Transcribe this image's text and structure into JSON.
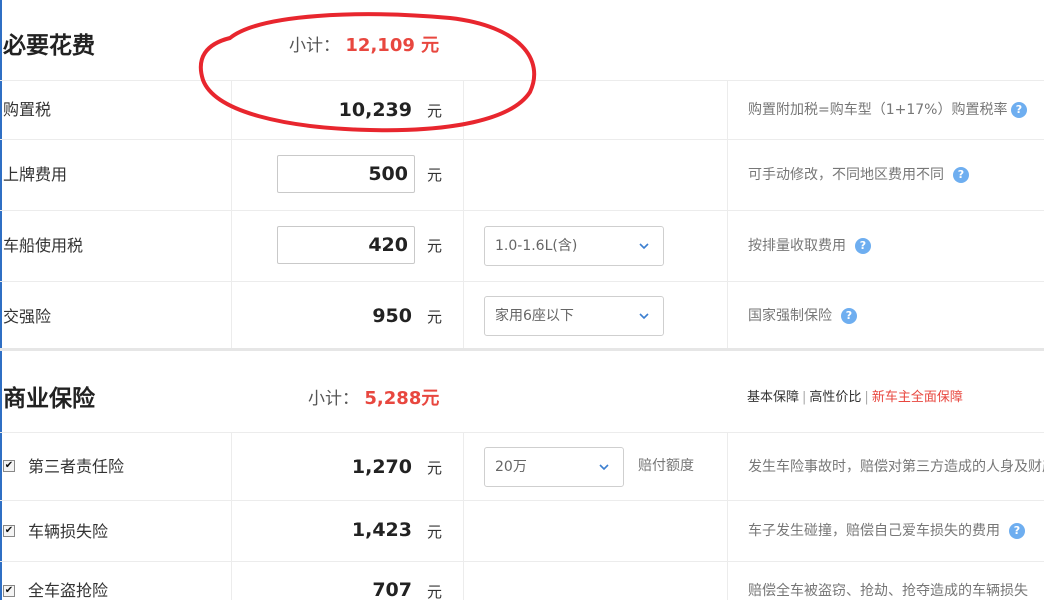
{
  "required": {
    "title": "必要花费",
    "subtotal_label": "小计：",
    "subtotal_value": "12,109 元",
    "rows": [
      {
        "label": "购置税",
        "amount": "10,239",
        "unit": "元",
        "desc": "购置附加税=购车型（1+17%）购置税率"
      },
      {
        "label": "上牌费用",
        "input_value": "500",
        "unit": "元",
        "desc": "可手动修改，不同地区费用不同"
      },
      {
        "label": "车船使用税",
        "input_value": "420",
        "unit": "元",
        "select": "1.0-1.6L(含)",
        "desc": "按排量收取费用"
      },
      {
        "label": "交强险",
        "amount": "950",
        "unit": "元",
        "select": "家用6座以下",
        "desc": "国家强制保险"
      }
    ]
  },
  "commercial": {
    "title": "商业保险",
    "subtotal_label": "小计：",
    "subtotal_value": "5,288元",
    "plans": [
      "基本保障",
      "高性价比",
      "新车主全面保障"
    ],
    "rows": [
      {
        "label": "第三者责任险",
        "checked": true,
        "amount": "1,270",
        "unit": "元",
        "select": "20万",
        "select_note": "赔付额度",
        "desc": "发生车险事故时，赔偿对第三方造成的人身及财产"
      },
      {
        "label": "车辆损失险",
        "checked": true,
        "amount": "1,423",
        "unit": "元",
        "desc": "车子发生碰撞，赔偿自己爱车损失的费用"
      },
      {
        "label": "全车盗抢险",
        "checked": true,
        "amount": "707",
        "unit": "元",
        "desc": "赔偿全车被盗窃、抢劫、抢夺造成的车辆损失"
      }
    ]
  },
  "help_glyph": "?",
  "check_glyph": "✔",
  "colors": {
    "accent_red": "#e8473f",
    "help_blue": "#6eaef0",
    "annotation_red": "#e8262e"
  }
}
